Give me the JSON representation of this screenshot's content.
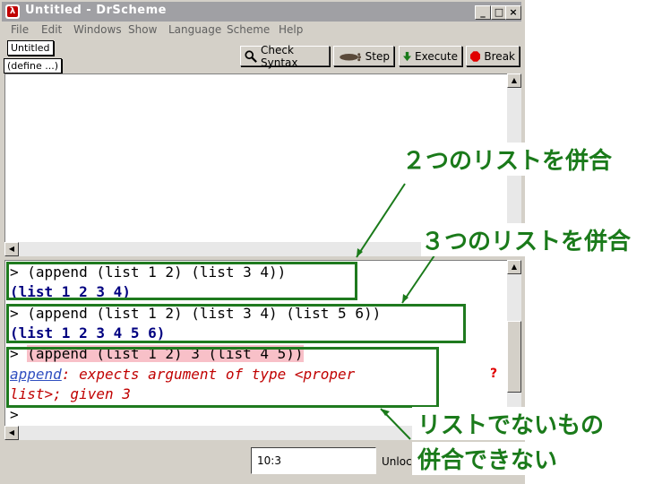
{
  "window": {
    "title": "Untitled - DrScheme",
    "app_icon_glyph": "λ",
    "minimize_glyph": "_",
    "maximize_glyph": "□",
    "close_glyph": "×"
  },
  "menu": [
    "File",
    "Edit",
    "Windows",
    "Show",
    "Language",
    "Scheme",
    "Help"
  ],
  "toolbar": {
    "file_name": "Untitled",
    "define_label": "(define ...)",
    "check_syntax": "Check Syntax",
    "step": "Step",
    "execute": "Execute",
    "break": "Break"
  },
  "interactions": [
    {
      "type": "input",
      "prompt": "> ",
      "text": "(append (list 1 2) (list 3 4))"
    },
    {
      "type": "output",
      "text": "(list 1 2 3 4)"
    },
    {
      "type": "input",
      "prompt": "> ",
      "text": "(append (list 1 2) (list 3 4) (list 5 6))"
    },
    {
      "type": "output",
      "text": "(list 1 2 3 4 5 6)"
    },
    {
      "type": "input",
      "prompt": "> ",
      "text": "(append (list 1 2) 3 (list 4 5))"
    },
    {
      "type": "error",
      "link": "append",
      "text": ": expects argument of type <proper"
    },
    {
      "type": "error",
      "text": "list>; given 3"
    },
    {
      "type": "prompt",
      "prompt": ">"
    }
  ],
  "status": {
    "position": "10:3",
    "lock_text": "Unlocked"
  },
  "annotations": {
    "two_lists": "２つのリストを併合",
    "three_lists": "３つのリストを併合",
    "non_list_line1": "リストでないもの",
    "non_list_line2": "併合できない"
  },
  "colors": {
    "annotation": "#1a7a1a",
    "output": "#000080",
    "error": "#c00000",
    "highlight": "#f8c0c8"
  }
}
